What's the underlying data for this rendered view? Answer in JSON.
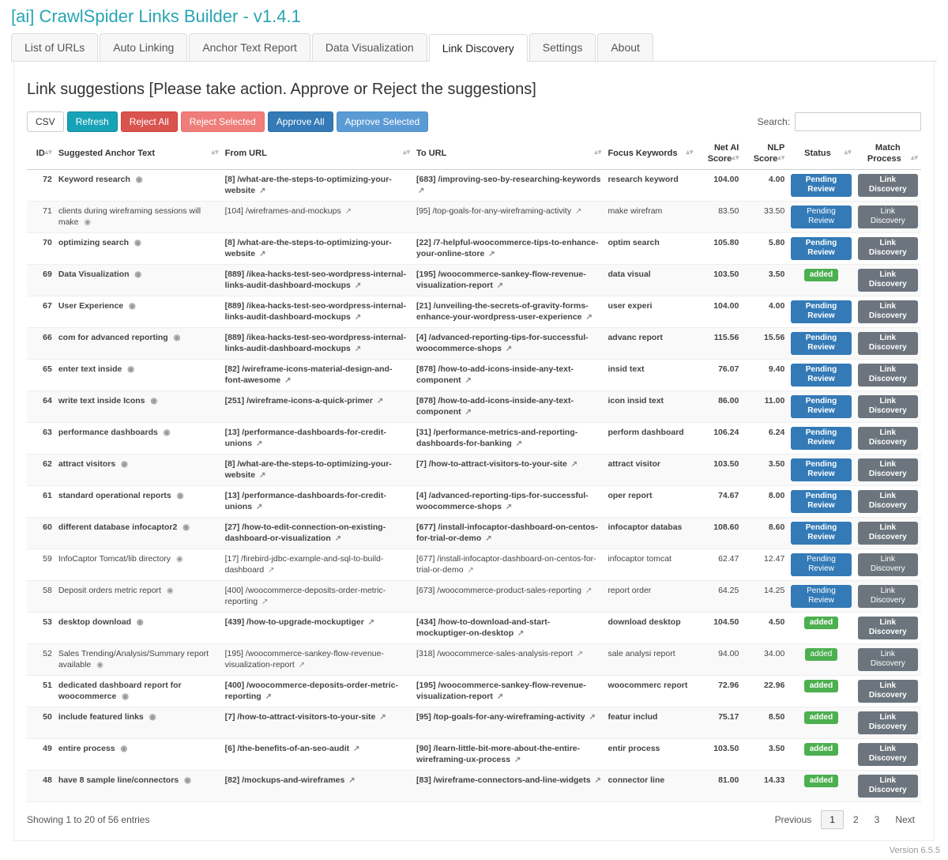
{
  "app": {
    "title": "[ai] CrawlSpider Links Builder - v1.4.1",
    "version_footer": "Version 6.5.5"
  },
  "tabs": {
    "items": [
      "List of URLs",
      "Auto Linking",
      "Anchor Text Report",
      "Data Visualization",
      "Link Discovery",
      "Settings",
      "About"
    ],
    "active_index": 4
  },
  "panel": {
    "heading": "Link suggestions [Please take action. Approve or Reject the suggestions]"
  },
  "toolbar": {
    "csv": "CSV",
    "refresh": "Refresh",
    "reject_all": "Reject All",
    "reject_selected": "Reject Selected",
    "approve_all": "Approve All",
    "approve_selected": "Approve Selected",
    "search_label": "Search:"
  },
  "columns": {
    "id": "ID",
    "anchor": "Suggested Anchor Text",
    "from": "From URL",
    "to": "To URL",
    "focus": "Focus Keywords",
    "net": "Net AI Score",
    "nlp": "NLP Score",
    "status": "Status",
    "match": "Match Process"
  },
  "status_label": {
    "pending": "Pending Review",
    "added": "added"
  },
  "match_label": "Link Discovery",
  "rows": [
    {
      "id": 72,
      "bold": true,
      "anchor": "Keyword research",
      "from_n": 8,
      "from": "/what-are-the-steps-to-optimizing-your-website",
      "to_n": 683,
      "to": "/improving-seo-by-researching-keywords",
      "focus": "research keyword",
      "net": "104.00",
      "nlp": "4.00",
      "status": "pending"
    },
    {
      "id": 71,
      "bold": false,
      "anchor": "clients during wireframing sessions will make",
      "from_n": 104,
      "from": "/wireframes-and-mockups",
      "to_n": 95,
      "to": "/top-goals-for-any-wireframing-activity",
      "focus": "make wirefram",
      "net": "83.50",
      "nlp": "33.50",
      "status": "pending"
    },
    {
      "id": 70,
      "bold": true,
      "anchor": "optimizing search",
      "from_n": 8,
      "from": "/what-are-the-steps-to-optimizing-your-website",
      "to_n": 22,
      "to": "/7-helpful-woocommerce-tips-to-enhance-your-online-store",
      "focus": "optim search",
      "net": "105.80",
      "nlp": "5.80",
      "status": "pending"
    },
    {
      "id": 69,
      "bold": true,
      "anchor": "Data Visualization",
      "from_n": 889,
      "from": "/ikea-hacks-test-seo-wordpress-internal-links-audit-dashboard-mockups",
      "to_n": 195,
      "to": "/woocommerce-sankey-flow-revenue-visualization-report",
      "focus": "data visual",
      "net": "103.50",
      "nlp": "3.50",
      "status": "added"
    },
    {
      "id": 67,
      "bold": true,
      "anchor": "User Experience",
      "from_n": 889,
      "from": "/ikea-hacks-test-seo-wordpress-internal-links-audit-dashboard-mockups",
      "to_n": 21,
      "to": "/unveiling-the-secrets-of-gravity-forms-enhance-your-wordpress-user-experience",
      "focus": "user experi",
      "net": "104.00",
      "nlp": "4.00",
      "status": "pending"
    },
    {
      "id": 66,
      "bold": true,
      "anchor": "com for advanced reporting",
      "from_n": 889,
      "from": "/ikea-hacks-test-seo-wordpress-internal-links-audit-dashboard-mockups",
      "to_n": 4,
      "to": "/advanced-reporting-tips-for-successful-woocommerce-shops",
      "focus": "advanc report",
      "net": "115.56",
      "nlp": "15.56",
      "status": "pending"
    },
    {
      "id": 65,
      "bold": true,
      "anchor": "enter text inside",
      "from_n": 82,
      "from": "/wireframe-icons-material-design-and-font-awesome",
      "to_n": 878,
      "to": "/how-to-add-icons-inside-any-text-component",
      "focus": "insid text",
      "net": "76.07",
      "nlp": "9.40",
      "status": "pending"
    },
    {
      "id": 64,
      "bold": true,
      "anchor": "write text inside Icons",
      "from_n": 251,
      "from": "/wireframe-icons-a-quick-primer",
      "to_n": 878,
      "to": "/how-to-add-icons-inside-any-text-component",
      "focus": "icon insid text",
      "net": "86.00",
      "nlp": "11.00",
      "status": "pending"
    },
    {
      "id": 63,
      "bold": true,
      "anchor": "performance dashboards",
      "from_n": 13,
      "from": "/performance-dashboards-for-credit-unions",
      "to_n": 31,
      "to": "/performance-metrics-and-reporting-dashboards-for-banking",
      "focus": "perform dashboard",
      "net": "106.24",
      "nlp": "6.24",
      "status": "pending"
    },
    {
      "id": 62,
      "bold": true,
      "anchor": "attract visitors",
      "from_n": 8,
      "from": "/what-are-the-steps-to-optimizing-your-website",
      "to_n": 7,
      "to": "/how-to-attract-visitors-to-your-site",
      "focus": "attract visitor",
      "net": "103.50",
      "nlp": "3.50",
      "status": "pending"
    },
    {
      "id": 61,
      "bold": true,
      "anchor": "standard operational reports",
      "from_n": 13,
      "from": "/performance-dashboards-for-credit-unions",
      "to_n": 4,
      "to": "/advanced-reporting-tips-for-successful-woocommerce-shops",
      "focus": "oper report",
      "net": "74.67",
      "nlp": "8.00",
      "status": "pending"
    },
    {
      "id": 60,
      "bold": true,
      "anchor": "different database infocaptor2",
      "from_n": 27,
      "from": "/how-to-edit-connection-on-existing-dashboard-or-visualization",
      "to_n": 677,
      "to": "/install-infocaptor-dashboard-on-centos-for-trial-or-demo",
      "focus": "infocaptor databas",
      "net": "108.60",
      "nlp": "8.60",
      "status": "pending"
    },
    {
      "id": 59,
      "bold": false,
      "anchor": "InfoCaptor Tomcat/lib directory",
      "from_n": 17,
      "from": "/firebird-jdbc-example-and-sql-to-build-dashboard",
      "to_n": 677,
      "to": "/install-infocaptor-dashboard-on-centos-for-trial-or-demo",
      "focus": "infocaptor tomcat",
      "net": "62.47",
      "nlp": "12.47",
      "status": "pending"
    },
    {
      "id": 58,
      "bold": false,
      "anchor": "Deposit orders metric report",
      "from_n": 400,
      "from": "/woocommerce-deposits-order-metric-reporting",
      "to_n": 673,
      "to": "/woocommerce-product-sales-reporting",
      "focus": "report order",
      "net": "64.25",
      "nlp": "14.25",
      "status": "pending"
    },
    {
      "id": 53,
      "bold": true,
      "anchor": "desktop download",
      "from_n": 439,
      "from": "/how-to-upgrade-mockuptiger",
      "to_n": 434,
      "to": "/how-to-download-and-start-mockuptiger-on-desktop",
      "focus": "download desktop",
      "net": "104.50",
      "nlp": "4.50",
      "status": "added"
    },
    {
      "id": 52,
      "bold": false,
      "anchor": "Sales Trending/Analysis/Summary report available",
      "from_n": 195,
      "from": "/woocommerce-sankey-flow-revenue-visualization-report",
      "to_n": 318,
      "to": "/woocommerce-sales-analysis-report",
      "focus": "sale analysi report",
      "net": "94.00",
      "nlp": "34.00",
      "status": "added"
    },
    {
      "id": 51,
      "bold": true,
      "anchor": "dedicated dashboard report for woocommerce",
      "from_n": 400,
      "from": "/woocommerce-deposits-order-metric-reporting",
      "to_n": 195,
      "to": "/woocommerce-sankey-flow-revenue-visualization-report",
      "focus": "woocommerc report",
      "net": "72.96",
      "nlp": "22.96",
      "status": "added"
    },
    {
      "id": 50,
      "bold": true,
      "anchor": "include featured links",
      "from_n": 7,
      "from": "/how-to-attract-visitors-to-your-site",
      "to_n": 95,
      "to": "/top-goals-for-any-wireframing-activity",
      "focus": "featur includ",
      "net": "75.17",
      "nlp": "8.50",
      "status": "added"
    },
    {
      "id": 49,
      "bold": true,
      "anchor": "entire process",
      "from_n": 6,
      "from": "/the-benefits-of-an-seo-audit",
      "to_n": 90,
      "to": "/learn-little-bit-more-about-the-entire-wireframing-ux-process",
      "focus": "entir process",
      "net": "103.50",
      "nlp": "3.50",
      "status": "added"
    },
    {
      "id": 48,
      "bold": true,
      "anchor": "have 8 sample line/connectors",
      "from_n": 82,
      "from": "/mockups-and-wireframes",
      "to_n": 83,
      "to": "/wireframe-connectors-and-line-widgets",
      "focus": "connector line",
      "net": "81.00",
      "nlp": "14.33",
      "status": "added"
    }
  ],
  "footer": {
    "showing": "Showing 1 to 20 of 56 entries",
    "prev": "Previous",
    "next": "Next",
    "pages": [
      "1",
      "2",
      "3"
    ],
    "current": 0
  }
}
